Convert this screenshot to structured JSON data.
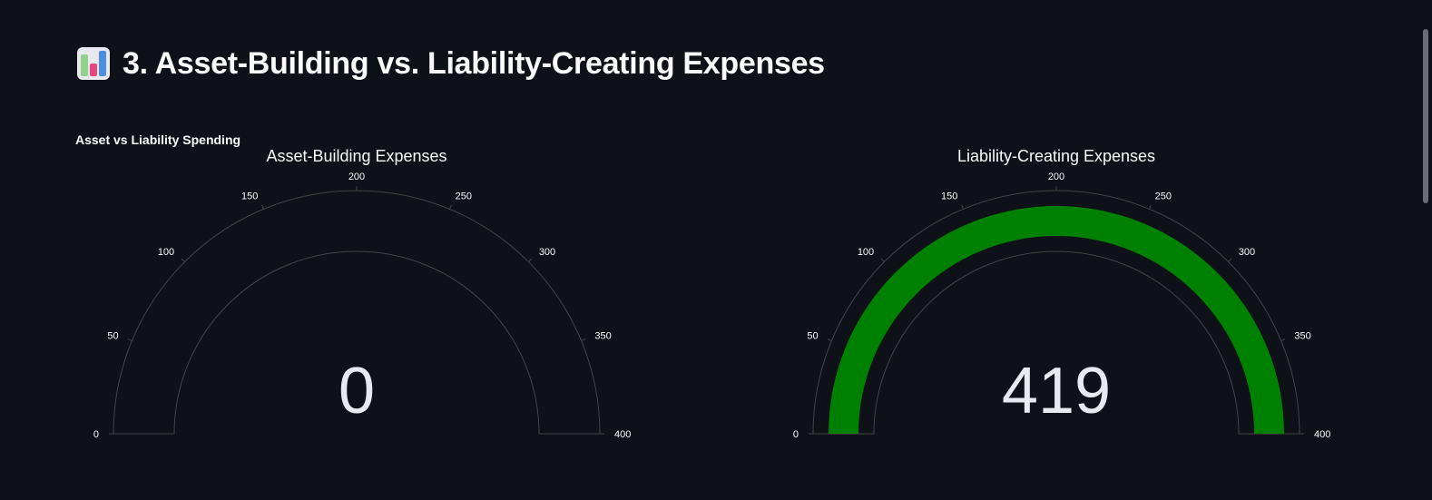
{
  "section": {
    "heading": "3. Asset-Building vs. Liability-Creating Expenses",
    "icon": "bar-chart-icon"
  },
  "chart_label": "Asset vs Liability Spending",
  "chart_data": [
    {
      "type": "gauge",
      "title": "Asset-Building Expenses",
      "value": 0,
      "value_label": "0",
      "range": [
        0,
        400
      ],
      "ticks": [
        0,
        50,
        100,
        150,
        200,
        250,
        300,
        350,
        400
      ],
      "tick_labels": [
        "0",
        "50",
        "100",
        "150",
        "200",
        "250",
        "300",
        "350",
        "400"
      ],
      "bar_color": "#008000"
    },
    {
      "type": "gauge",
      "title": "Liability-Creating Expenses",
      "value": 419,
      "value_label": "419",
      "range": [
        0,
        400
      ],
      "ticks": [
        0,
        50,
        100,
        150,
        200,
        250,
        300,
        350,
        400
      ],
      "tick_labels": [
        "0",
        "50",
        "100",
        "150",
        "200",
        "250",
        "300",
        "350",
        "400"
      ],
      "bar_color": "#008000"
    }
  ],
  "colors": {
    "background": "#0e1117",
    "text": "#fafafa",
    "gauge_outline": "#444444",
    "bar": "#008000"
  }
}
